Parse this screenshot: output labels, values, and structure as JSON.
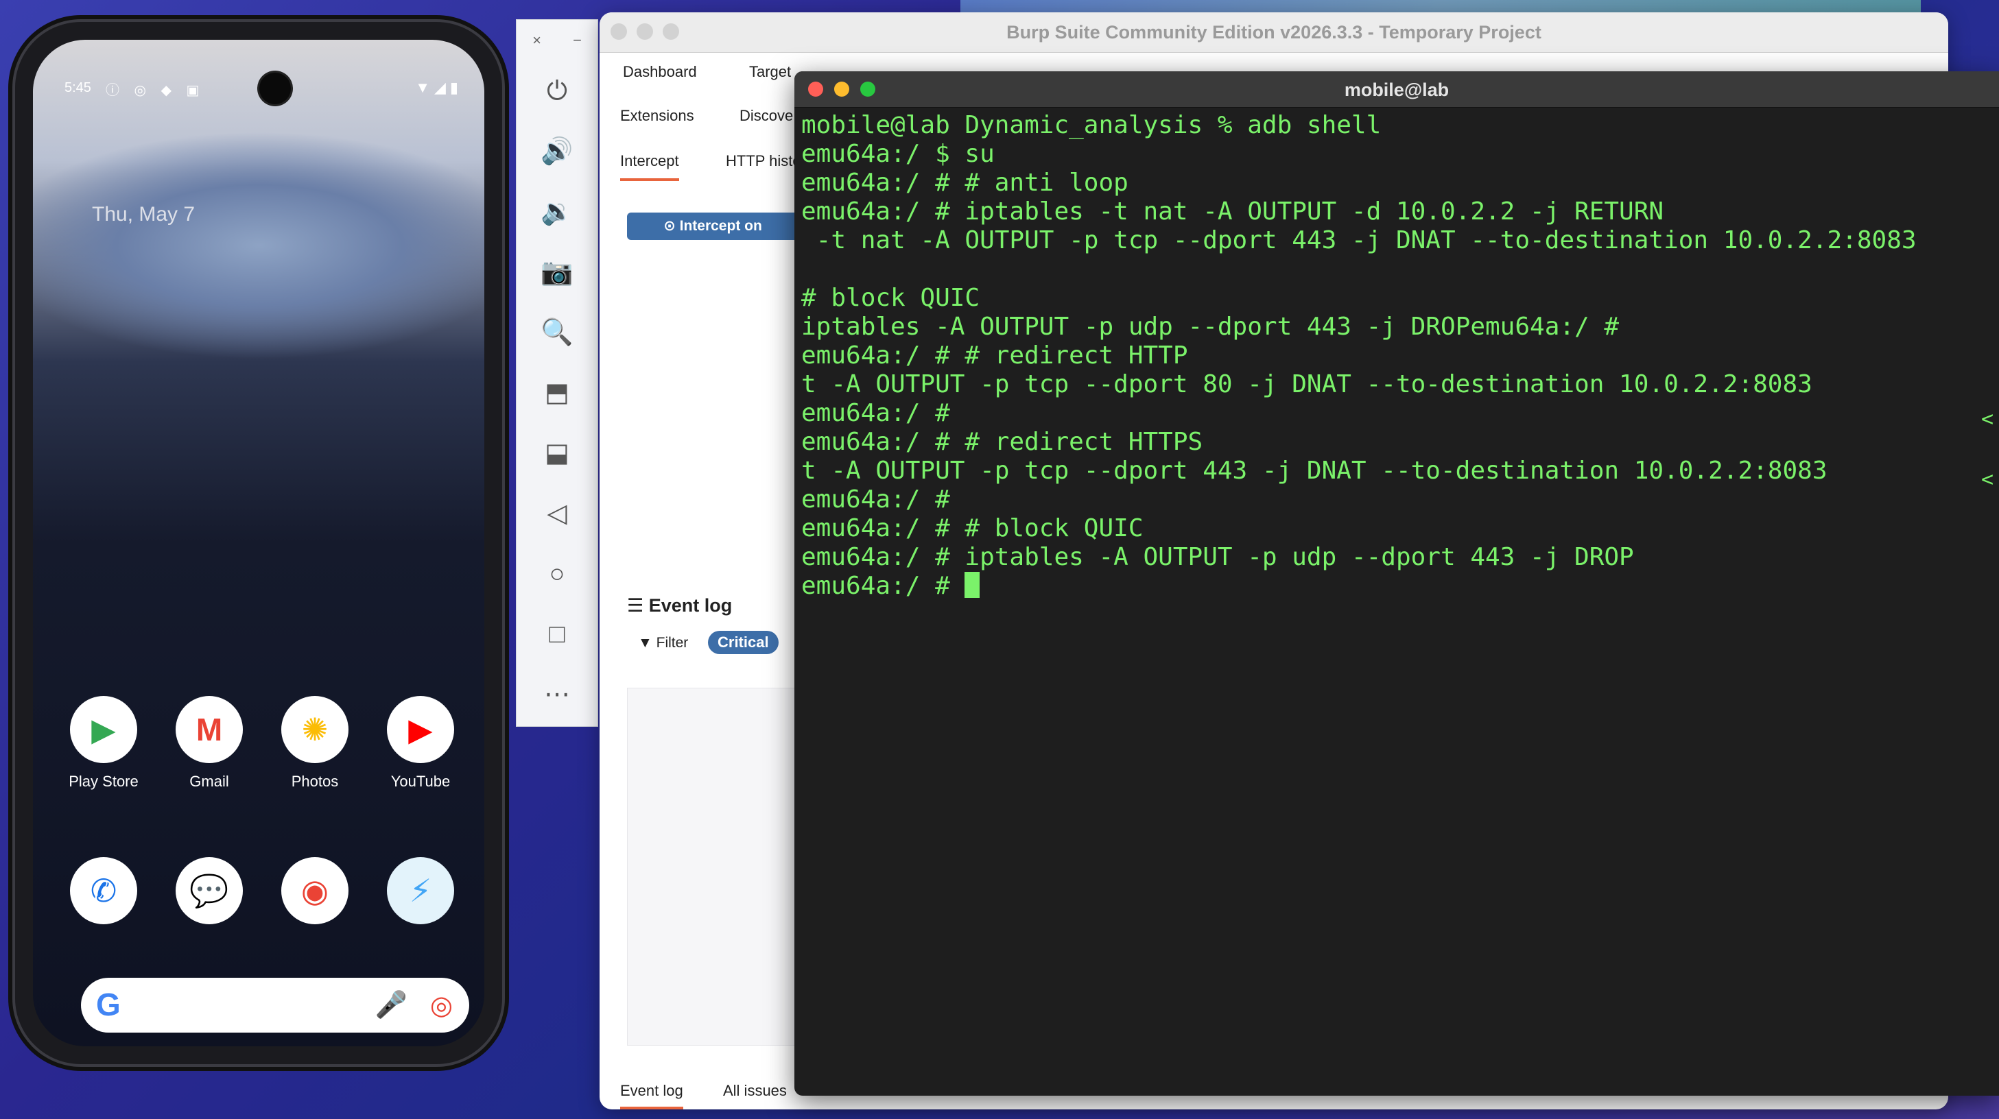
{
  "phone": {
    "status_time": "5:45",
    "status_left_icons": "ⓘ ◎ ◆ ▣",
    "status_right_icons": "▼◢▮",
    "date": "Thu, May 7",
    "apps_row1": [
      {
        "label": "Play Store",
        "glyph": "▶",
        "color": "#34a853"
      },
      {
        "label": "Gmail",
        "glyph": "M",
        "color": "#ea4335"
      },
      {
        "label": "Photos",
        "glyph": "✺",
        "color": "#fbbc05"
      },
      {
        "label": "YouTube",
        "glyph": "▶",
        "color": "#ff0000"
      }
    ],
    "apps_row2": [
      {
        "label": "",
        "glyph": "✆",
        "color": "#1a73e8"
      },
      {
        "label": "",
        "glyph": "💬",
        "color": "#1a73e8"
      },
      {
        "label": "",
        "glyph": "◉",
        "color": "#ea4335"
      },
      {
        "label": "",
        "glyph": "⚡",
        "color": "#42a5f5"
      }
    ],
    "search_logo": "G",
    "search_mic": "🎤",
    "search_lens": "◎"
  },
  "emulator": {
    "close": "×",
    "minimize": "−",
    "buttons": [
      "⏻",
      "🔊",
      "🔉",
      "📷",
      "🔍",
      "⬒",
      "⬓",
      "◁",
      "○",
      "□",
      "⋯"
    ]
  },
  "burp": {
    "title": "Burp Suite Community Edition v2026.3.3 - Temporary Project",
    "tabs_row1": [
      "Dashboard",
      "Target"
    ],
    "tabs_row2": [
      "Extensions",
      "Discove"
    ],
    "subtabs": [
      "Intercept",
      "HTTP histo"
    ],
    "intercept_button": "Intercept on",
    "event_log_title": "Event log",
    "filter_label": "Filter",
    "critical_chip": "Critical",
    "bottom_tabs": [
      "Event log",
      "All issues"
    ]
  },
  "terminal": {
    "title": "mobile@lab",
    "lines": [
      "mobile@lab Dynamic_analysis % adb shell",
      "emu64a:/ $ su",
      "emu64a:/ # # anti loop",
      "emu64a:/ # iptables -t nat -A OUTPUT -d 10.0.2.2 -j RETURN",
      " -t nat -A OUTPUT -p tcp --dport 443 -j DNAT --to-destination 10.0.2.2:8083",
      "",
      "# block QUIC",
      "iptables -A OUTPUT -p udp --dport 443 -j DROPemu64a:/ #",
      "emu64a:/ # # redirect HTTP",
      "t -A OUTPUT -p tcp --dport 80 -j DNAT --to-destination 10.0.2.2:8083",
      "emu64a:/ #",
      "emu64a:/ # # redirect HTTPS",
      "t -A OUTPUT -p tcp --dport 443 -j DNAT --to-destination 10.0.2.2:8083",
      "emu64a:/ #",
      "emu64a:/ # # block QUIC",
      "emu64a:/ # iptables -A OUTPUT -p udp --dport 443 -j DROP",
      "emu64a:/ # "
    ],
    "edge_marks": [
      "<",
      "<"
    ],
    "text_color": "#7bf26a"
  }
}
